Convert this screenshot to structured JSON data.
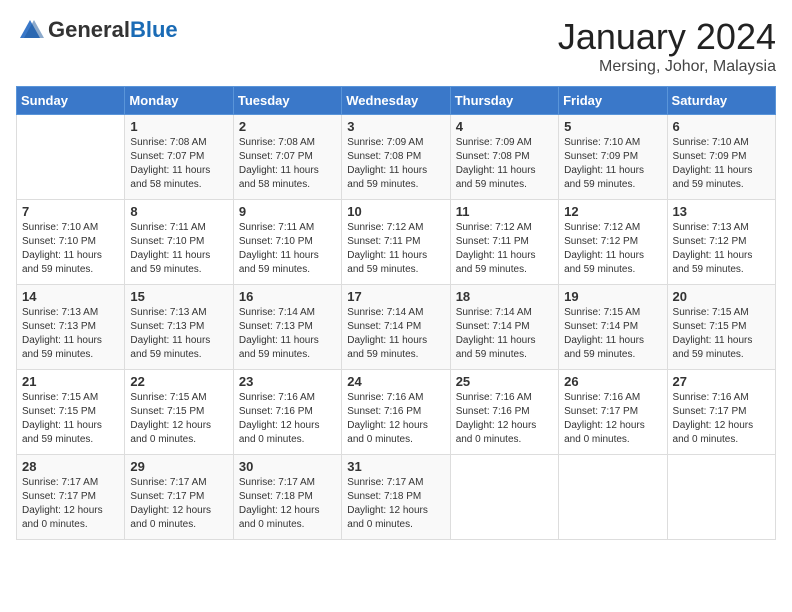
{
  "header": {
    "logo_general": "General",
    "logo_blue": "Blue",
    "month_year": "January 2024",
    "location": "Mersing, Johor, Malaysia"
  },
  "weekdays": [
    "Sunday",
    "Monday",
    "Tuesday",
    "Wednesday",
    "Thursday",
    "Friday",
    "Saturday"
  ],
  "weeks": [
    [
      {
        "day": "",
        "info": ""
      },
      {
        "day": "1",
        "info": "Sunrise: 7:08 AM\nSunset: 7:07 PM\nDaylight: 11 hours\nand 58 minutes."
      },
      {
        "day": "2",
        "info": "Sunrise: 7:08 AM\nSunset: 7:07 PM\nDaylight: 11 hours\nand 58 minutes."
      },
      {
        "day": "3",
        "info": "Sunrise: 7:09 AM\nSunset: 7:08 PM\nDaylight: 11 hours\nand 59 minutes."
      },
      {
        "day": "4",
        "info": "Sunrise: 7:09 AM\nSunset: 7:08 PM\nDaylight: 11 hours\nand 59 minutes."
      },
      {
        "day": "5",
        "info": "Sunrise: 7:10 AM\nSunset: 7:09 PM\nDaylight: 11 hours\nand 59 minutes."
      },
      {
        "day": "6",
        "info": "Sunrise: 7:10 AM\nSunset: 7:09 PM\nDaylight: 11 hours\nand 59 minutes."
      }
    ],
    [
      {
        "day": "7",
        "info": "Sunrise: 7:10 AM\nSunset: 7:10 PM\nDaylight: 11 hours\nand 59 minutes."
      },
      {
        "day": "8",
        "info": "Sunrise: 7:11 AM\nSunset: 7:10 PM\nDaylight: 11 hours\nand 59 minutes."
      },
      {
        "day": "9",
        "info": "Sunrise: 7:11 AM\nSunset: 7:10 PM\nDaylight: 11 hours\nand 59 minutes."
      },
      {
        "day": "10",
        "info": "Sunrise: 7:12 AM\nSunset: 7:11 PM\nDaylight: 11 hours\nand 59 minutes."
      },
      {
        "day": "11",
        "info": "Sunrise: 7:12 AM\nSunset: 7:11 PM\nDaylight: 11 hours\nand 59 minutes."
      },
      {
        "day": "12",
        "info": "Sunrise: 7:12 AM\nSunset: 7:12 PM\nDaylight: 11 hours\nand 59 minutes."
      },
      {
        "day": "13",
        "info": "Sunrise: 7:13 AM\nSunset: 7:12 PM\nDaylight: 11 hours\nand 59 minutes."
      }
    ],
    [
      {
        "day": "14",
        "info": "Sunrise: 7:13 AM\nSunset: 7:13 PM\nDaylight: 11 hours\nand 59 minutes."
      },
      {
        "day": "15",
        "info": "Sunrise: 7:13 AM\nSunset: 7:13 PM\nDaylight: 11 hours\nand 59 minutes."
      },
      {
        "day": "16",
        "info": "Sunrise: 7:14 AM\nSunset: 7:13 PM\nDaylight: 11 hours\nand 59 minutes."
      },
      {
        "day": "17",
        "info": "Sunrise: 7:14 AM\nSunset: 7:14 PM\nDaylight: 11 hours\nand 59 minutes."
      },
      {
        "day": "18",
        "info": "Sunrise: 7:14 AM\nSunset: 7:14 PM\nDaylight: 11 hours\nand 59 minutes."
      },
      {
        "day": "19",
        "info": "Sunrise: 7:15 AM\nSunset: 7:14 PM\nDaylight: 11 hours\nand 59 minutes."
      },
      {
        "day": "20",
        "info": "Sunrise: 7:15 AM\nSunset: 7:15 PM\nDaylight: 11 hours\nand 59 minutes."
      }
    ],
    [
      {
        "day": "21",
        "info": "Sunrise: 7:15 AM\nSunset: 7:15 PM\nDaylight: 11 hours\nand 59 minutes."
      },
      {
        "day": "22",
        "info": "Sunrise: 7:15 AM\nSunset: 7:15 PM\nDaylight: 12 hours\nand 0 minutes."
      },
      {
        "day": "23",
        "info": "Sunrise: 7:16 AM\nSunset: 7:16 PM\nDaylight: 12 hours\nand 0 minutes."
      },
      {
        "day": "24",
        "info": "Sunrise: 7:16 AM\nSunset: 7:16 PM\nDaylight: 12 hours\nand 0 minutes."
      },
      {
        "day": "25",
        "info": "Sunrise: 7:16 AM\nSunset: 7:16 PM\nDaylight: 12 hours\nand 0 minutes."
      },
      {
        "day": "26",
        "info": "Sunrise: 7:16 AM\nSunset: 7:17 PM\nDaylight: 12 hours\nand 0 minutes."
      },
      {
        "day": "27",
        "info": "Sunrise: 7:16 AM\nSunset: 7:17 PM\nDaylight: 12 hours\nand 0 minutes."
      }
    ],
    [
      {
        "day": "28",
        "info": "Sunrise: 7:17 AM\nSunset: 7:17 PM\nDaylight: 12 hours\nand 0 minutes."
      },
      {
        "day": "29",
        "info": "Sunrise: 7:17 AM\nSunset: 7:17 PM\nDaylight: 12 hours\nand 0 minutes."
      },
      {
        "day": "30",
        "info": "Sunrise: 7:17 AM\nSunset: 7:18 PM\nDaylight: 12 hours\nand 0 minutes."
      },
      {
        "day": "31",
        "info": "Sunrise: 7:17 AM\nSunset: 7:18 PM\nDaylight: 12 hours\nand 0 minutes."
      },
      {
        "day": "",
        "info": ""
      },
      {
        "day": "",
        "info": ""
      },
      {
        "day": "",
        "info": ""
      }
    ]
  ]
}
